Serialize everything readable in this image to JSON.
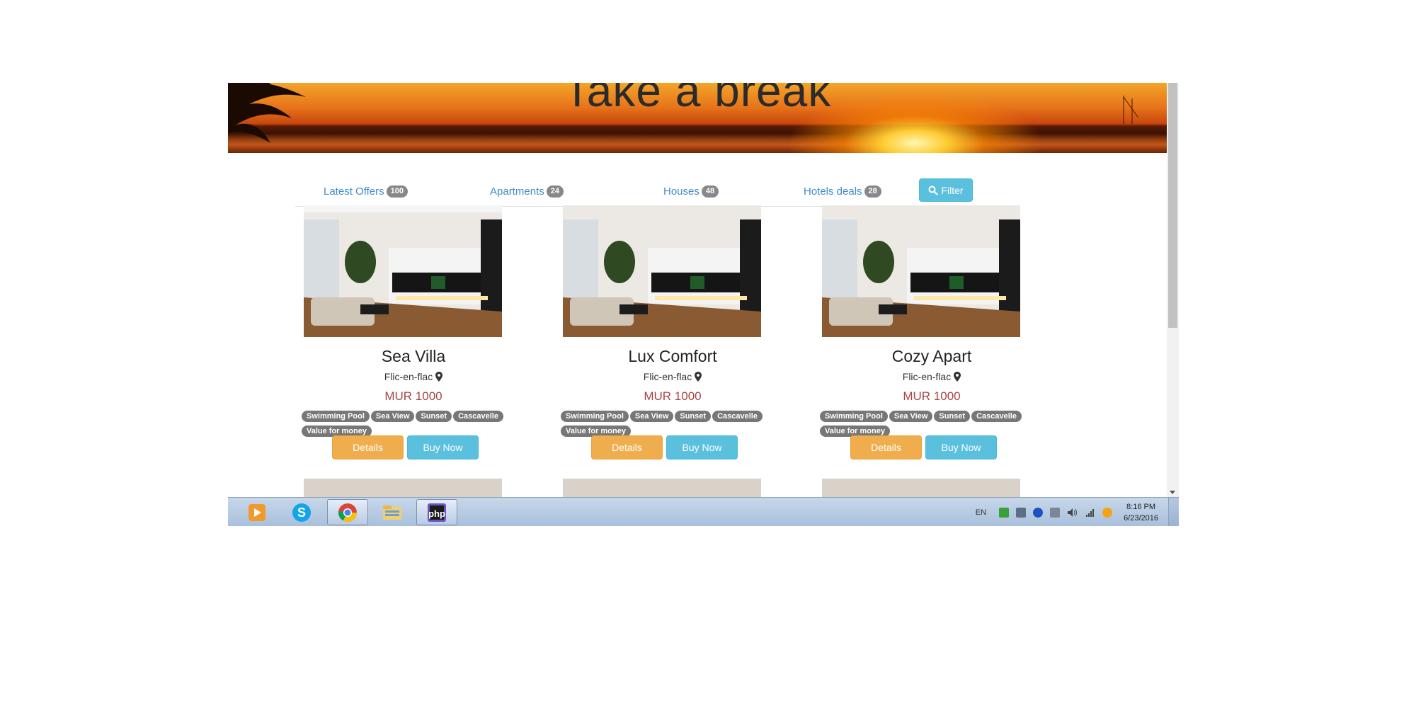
{
  "hero": {
    "title": "Take a break"
  },
  "nav": {
    "tabs": [
      {
        "label": "Latest Offers",
        "count": "100"
      },
      {
        "label": "Apartments",
        "count": "24"
      },
      {
        "label": "Houses",
        "count": "48"
      },
      {
        "label": "Hotels deals",
        "count": "28"
      }
    ],
    "filter_label": "Filter"
  },
  "listings": [
    {
      "name": "Sea Villa",
      "location": "Flic-en-flac",
      "price": "MUR 1000",
      "tags": [
        "Swimming Pool",
        "Sea View",
        "Sunset",
        "Cascavelle",
        "Value for money"
      ]
    },
    {
      "name": "Lux Comfort",
      "location": "Flic-en-flac",
      "price": "MUR 1000",
      "tags": [
        "Swimming Pool",
        "Sea View",
        "Sunset",
        "Cascavelle",
        "Value for money"
      ]
    },
    {
      "name": "Cozy Apart",
      "location": "Flic-en-flac",
      "price": "MUR 1000",
      "tags": [
        "Swimming Pool",
        "Sea View",
        "Sunset",
        "Cascavelle",
        "Value for money"
      ]
    }
  ],
  "buttons": {
    "details": "Details",
    "buy": "Buy Now"
  },
  "taskbar": {
    "apps": [
      "windows-media-player-icon",
      "skype-icon",
      "chrome-icon",
      "file-explorer-icon",
      "phpstorm-icon"
    ],
    "lang": "EN",
    "time": "8:16 PM",
    "date": "6/23/2016"
  },
  "colors": {
    "link": "#428bca",
    "info": "#5bc0de",
    "warning": "#f0ad4e",
    "price": "#a94442",
    "tag": "#777777"
  }
}
